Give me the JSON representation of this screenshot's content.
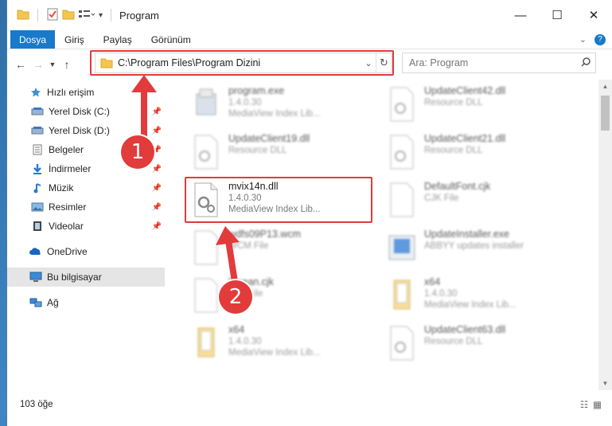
{
  "window": {
    "title": "Program",
    "controls": {
      "minimize": "—",
      "maximize": "☐",
      "close": "✕"
    }
  },
  "ribbon": {
    "file_tab": "Dosya",
    "tabs": [
      "Giriş",
      "Paylaş",
      "Görünüm"
    ]
  },
  "address": {
    "path": "C:\\Program Files\\Program Dizini"
  },
  "search": {
    "placeholder": "Ara: Program"
  },
  "sidebar": {
    "quick_access": "Hızlı erişim",
    "items": [
      {
        "label": "Yerel Disk (C:)",
        "icon": "drive-icon"
      },
      {
        "label": "Yerel Disk (D:)",
        "icon": "drive-icon"
      },
      {
        "label": "Belgeler",
        "icon": "documents-icon"
      },
      {
        "label": "İndirmeler",
        "icon": "downloads-icon"
      },
      {
        "label": "Müzik",
        "icon": "music-icon"
      },
      {
        "label": "Resimler",
        "icon": "pictures-icon"
      },
      {
        "label": "Videolar",
        "icon": "videos-icon"
      }
    ],
    "onedrive": "OneDrive",
    "this_pc": "Bu bilgisayar",
    "network": "Ağ"
  },
  "files": [
    {
      "name": "program.exe",
      "line2": "1.4.0.30",
      "line3": "MediaView Index Lib...",
      "icon": "exe-icon"
    },
    {
      "name": "UpdateClient42.dll",
      "line2": "Resource DLL",
      "line3": "",
      "icon": "dll-icon"
    },
    {
      "name": "UpdateClient19.dll",
      "line2": "Resource DLL",
      "line3": "",
      "icon": "dll-icon"
    },
    {
      "name": "UpdateClient21.dll",
      "line2": "Resource DLL",
      "line3": "",
      "icon": "dll-icon"
    },
    {
      "name": "mvix14n.dll",
      "line2": "1.4.0.30",
      "line3": "MediaView Index Lib...",
      "icon": "dll-icon"
    },
    {
      "name": "DefaultFont.cjk",
      "line2": "CJK File",
      "line3": "",
      "icon": "file-icon"
    },
    {
      "name": "wdfs09P13.wcm",
      "line2": "WCM File",
      "line3": "",
      "icon": "file-icon"
    },
    {
      "name": "UpdateInstaller.exe",
      "line2": "ABBYY updates installer",
      "line3": "",
      "icon": "installer-icon"
    },
    {
      "name": "korean.cjk",
      "line2": "CJK File",
      "line3": "",
      "icon": "file-icon"
    },
    {
      "name": "x64",
      "line2": "1.4.0.30",
      "line3": "MediaView Index Lib...",
      "icon": "folder-doc-icon"
    },
    {
      "name": "x64",
      "line2": "1.4.0.30",
      "line3": "MediaView Index Lib...",
      "icon": "folder-doc-icon"
    },
    {
      "name": "UpdateClient63.dll",
      "line2": "Resource DLL",
      "line3": "",
      "icon": "dll-icon"
    }
  ],
  "status": {
    "count": "103 öğe"
  },
  "callouts": [
    "1",
    "2"
  ],
  "colors": {
    "highlight": "#e23b3b",
    "file_tab": "#1979ca",
    "selection": "#e5e5e5"
  }
}
